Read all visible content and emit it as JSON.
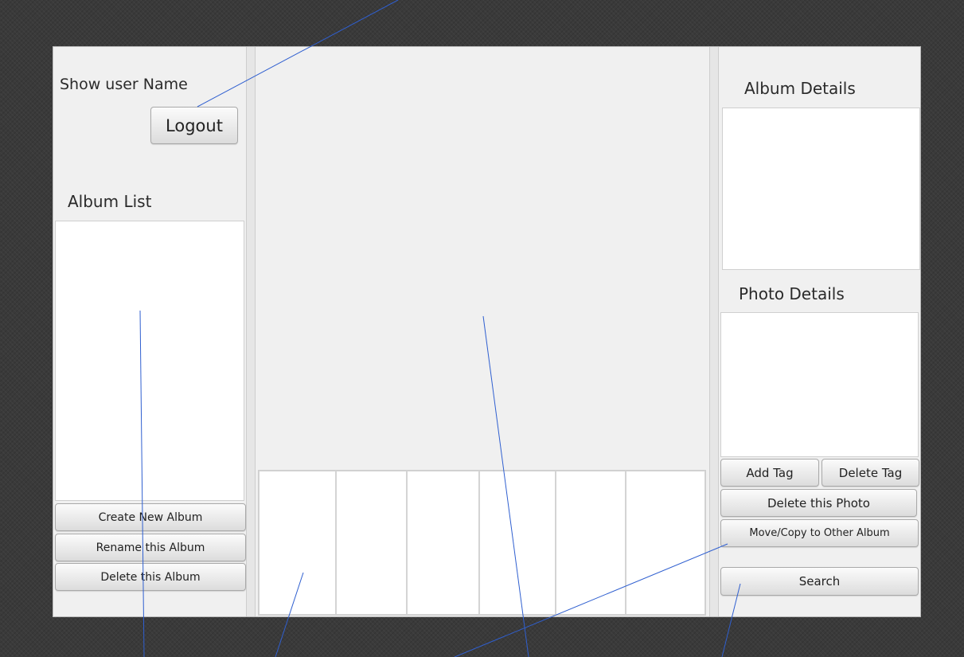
{
  "left_panel": {
    "user_name_label": "Show user Name",
    "logout_label": "Logout",
    "album_list_label": "Album List",
    "create_album_label": "Create New Album",
    "rename_album_label": "Rename this Album",
    "delete_album_label": "Delete this Album"
  },
  "center_panel": {
    "thumbnails": [
      "",
      "",
      "",
      "",
      "",
      ""
    ]
  },
  "right_panel": {
    "album_details_label": "Album Details",
    "photo_details_label": "Photo Details",
    "add_tag_label": "Add Tag",
    "delete_tag_label": "Delete Tag",
    "delete_photo_label": "Delete this Photo",
    "move_copy_label": "Move/Copy to Other Album",
    "search_label": "Search"
  },
  "annotation": {
    "line_color": "#2f5fd0"
  }
}
